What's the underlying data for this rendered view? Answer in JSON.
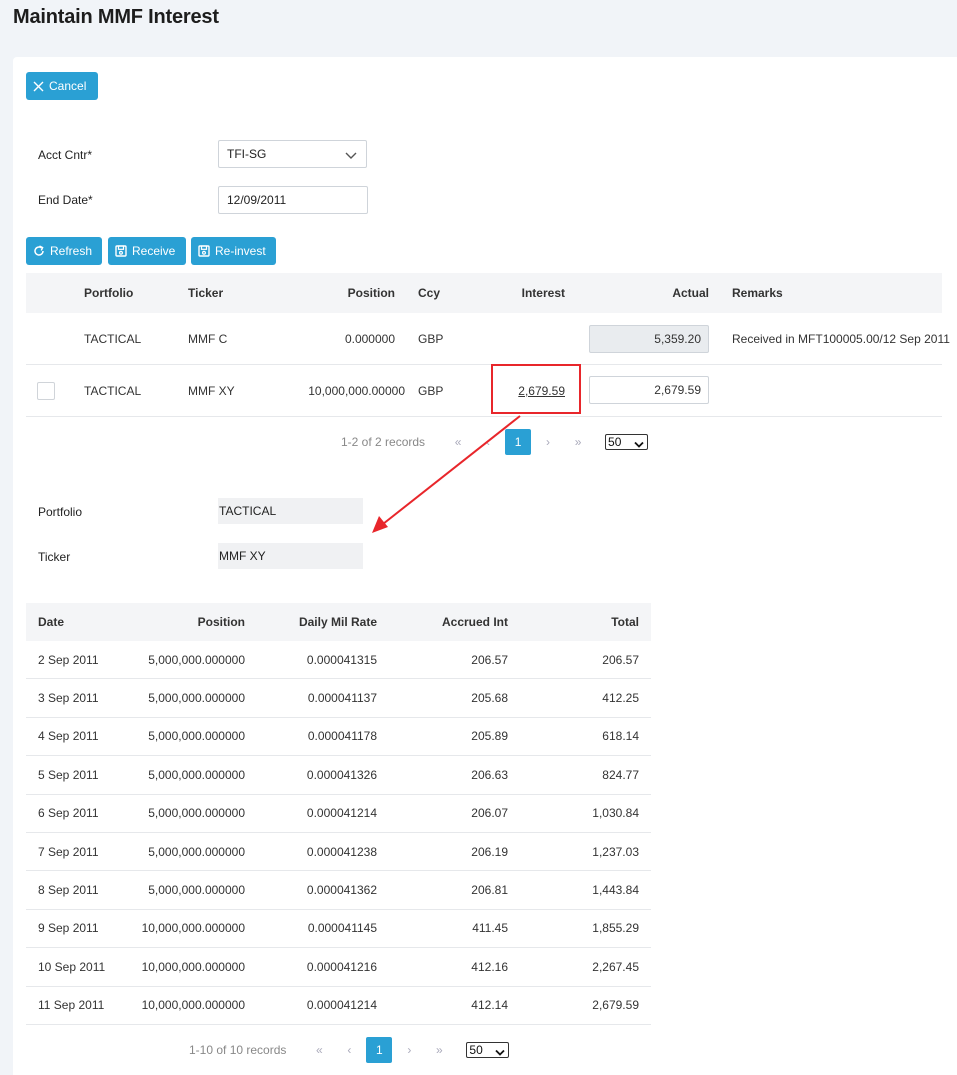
{
  "page": {
    "title": "Maintain MMF Interest"
  },
  "toolbar": {
    "cancel_label": "Cancel",
    "refresh_label": "Refresh",
    "receive_label": "Receive",
    "reinvest_label": "Re-invest"
  },
  "form": {
    "acct_cntr_label": "Acct Cntr*",
    "acct_cntr_value": "TFI-SG",
    "end_date_label": "End Date*",
    "end_date_value": "12/09/2011"
  },
  "interest_grid": {
    "columns": {
      "portfolio": "Portfolio",
      "ticker": "Ticker",
      "position": "Position",
      "ccy": "Ccy",
      "interest": "Interest",
      "actual": "Actual",
      "remarks": "Remarks"
    },
    "rows": [
      {
        "portfolio": "TACTICAL",
        "ticker": "MMF C",
        "position": "0.000000",
        "ccy": "GBP",
        "interest": "",
        "actual": "5,359.20",
        "remarks": "Received in MFT100005.00/12 Sep 2011"
      },
      {
        "portfolio": "TACTICAL",
        "ticker": "MMF XY",
        "position": "10,000,000.00000",
        "ccy": "GBP",
        "interest": "2,679.59",
        "actual": "2,679.59",
        "remarks": ""
      }
    ],
    "pager": {
      "info": "1-2 of 2 records",
      "first": "«",
      "prev": "‹",
      "current": "1",
      "next": "›",
      "last": "»",
      "page_size": "50"
    }
  },
  "detail": {
    "portfolio_label": "Portfolio",
    "portfolio_value": "TACTICAL",
    "ticker_label": "Ticker",
    "ticker_value": "MMF XY"
  },
  "accrual_grid": {
    "columns": {
      "date": "Date",
      "position": "Position",
      "rate": "Daily Mil Rate",
      "accrued": "Accrued Int",
      "total": "Total"
    },
    "rows": [
      {
        "date": "2 Sep 2011",
        "position": "5,000,000.000000",
        "rate": "0.000041315",
        "accrued": "206.57",
        "total": "206.57"
      },
      {
        "date": "3 Sep 2011",
        "position": "5,000,000.000000",
        "rate": "0.000041137",
        "accrued": "205.68",
        "total": "412.25"
      },
      {
        "date": "4 Sep 2011",
        "position": "5,000,000.000000",
        "rate": "0.000041178",
        "accrued": "205.89",
        "total": "618.14"
      },
      {
        "date": "5 Sep 2011",
        "position": "5,000,000.000000",
        "rate": "0.000041326",
        "accrued": "206.63",
        "total": "824.77"
      },
      {
        "date": "6 Sep 2011",
        "position": "5,000,000.000000",
        "rate": "0.000041214",
        "accrued": "206.07",
        "total": "1,030.84"
      },
      {
        "date": "7 Sep 2011",
        "position": "5,000,000.000000",
        "rate": "0.000041238",
        "accrued": "206.19",
        "total": "1,237.03"
      },
      {
        "date": "8 Sep 2011",
        "position": "5,000,000.000000",
        "rate": "0.000041362",
        "accrued": "206.81",
        "total": "1,443.84"
      },
      {
        "date": "9 Sep 2011",
        "position": "10,000,000.000000",
        "rate": "0.000041145",
        "accrued": "411.45",
        "total": "1,855.29"
      },
      {
        "date": "10 Sep 2011",
        "position": "10,000,000.000000",
        "rate": "0.000041216",
        "accrued": "412.16",
        "total": "2,267.45"
      },
      {
        "date": "11 Sep 2011",
        "position": "10,000,000.000000",
        "rate": "0.000041214",
        "accrued": "412.14",
        "total": "2,679.59"
      }
    ],
    "pager": {
      "info": "1-10 of 10 records",
      "first": "«",
      "prev": "‹",
      "current": "1",
      "next": "›",
      "last": "»",
      "page_size": "50"
    }
  },
  "annotation": {
    "color": "#e8262b"
  },
  "colors": {
    "accent": "#2aa0d4",
    "header_bg": "#f4f5f7",
    "page_bg": "#f1f4f8"
  }
}
